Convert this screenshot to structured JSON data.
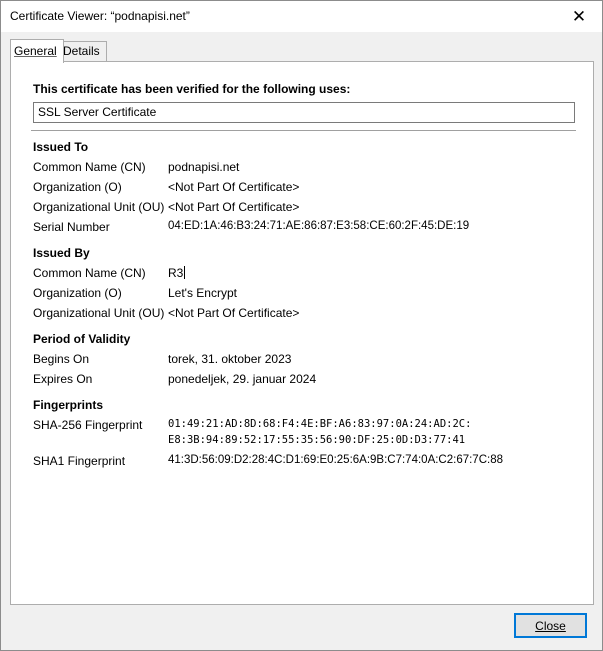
{
  "window": {
    "title": "Certificate Viewer: “podnapisi.net”",
    "close_glyph": "✕"
  },
  "tabs": [
    {
      "label": "General",
      "active": true
    },
    {
      "label": "Details",
      "active": false
    }
  ],
  "general": {
    "uses_heading": "This certificate has been verified for the following uses:",
    "uses_value": "SSL Server Certificate",
    "issued_to": {
      "heading": "Issued To",
      "rows": [
        {
          "label": "Common Name (CN)",
          "value": "podnapisi.net"
        },
        {
          "label": "Organization (O)",
          "value": "<Not Part Of Certificate>"
        },
        {
          "label": "Organizational Unit (OU)",
          "value": "<Not Part Of Certificate>"
        },
        {
          "label": "Serial Number",
          "value": "04:ED:1A:46:B3:24:71:AE:86:87:E3:58:CE:60:2F:45:DE:19"
        }
      ]
    },
    "issued_by": {
      "heading": "Issued By",
      "rows": [
        {
          "label": "Common Name (CN)",
          "value": "R3"
        },
        {
          "label": "Organization (O)",
          "value": "Let's Encrypt"
        },
        {
          "label": "Organizational Unit (OU)",
          "value": "<Not Part Of Certificate>"
        }
      ]
    },
    "validity": {
      "heading": "Period of Validity",
      "rows": [
        {
          "label": "Begins On",
          "value": "torek, 31. oktober 2023"
        },
        {
          "label": "Expires On",
          "value": "ponedeljek, 29. januar 2024"
        }
      ]
    },
    "fingerprints": {
      "heading": "Fingerprints",
      "sha256_label": "SHA-256 Fingerprint",
      "sha256_line1": "01:49:21:AD:8D:68:F4:4E:BF:A6:83:97:0A:24:AD:2C:",
      "sha256_line2": "E8:3B:94:89:52:17:55:35:56:90:DF:25:0D:D3:77:41",
      "sha1_label": "SHA1 Fingerprint",
      "sha1_value": "41:3D:56:09:D2:28:4C:D1:69:E0:25:6A:9B:C7:74:0A:C2:67:7C:88"
    }
  },
  "footer": {
    "close_label": "Close"
  }
}
